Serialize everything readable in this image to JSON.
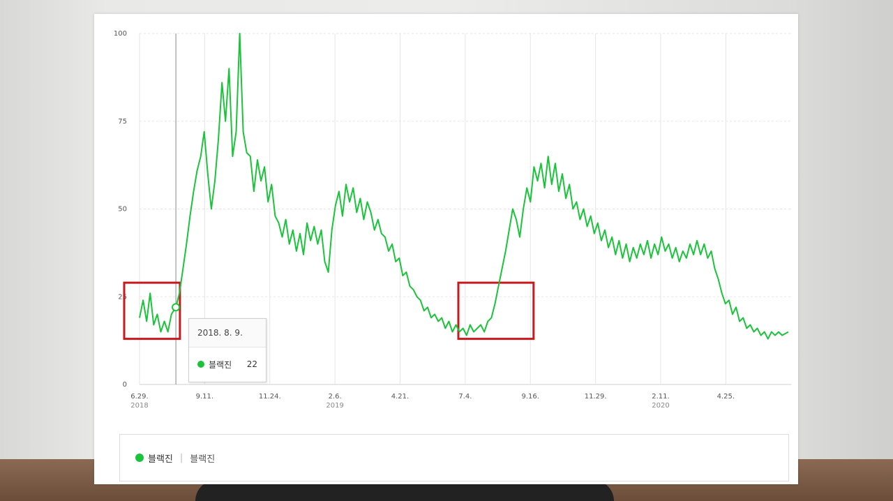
{
  "colors": {
    "line": "#1bc33b",
    "highlight": "#c8191e",
    "grid": "#e5e5e5"
  },
  "tooltip": {
    "date": "2018. 8. 9.",
    "series": "블랙진",
    "value": "22"
  },
  "legend": {
    "series_label": "블랙진",
    "series_sub": "블랙진"
  },
  "chart_data": {
    "type": "line",
    "x_start": "2018-06-29",
    "x_end": "2020-06-30",
    "ylim": [
      0,
      100
    ],
    "yticks": [
      "0",
      "25",
      "50",
      "75",
      "100"
    ],
    "xticks": [
      {
        "label": "6.29.",
        "year": "2018"
      },
      {
        "label": "9.11.",
        "year": ""
      },
      {
        "label": "11.24.",
        "year": ""
      },
      {
        "label": "2.6.",
        "year": "2019"
      },
      {
        "label": "4.21.",
        "year": ""
      },
      {
        "label": "7.4.",
        "year": ""
      },
      {
        "label": "9.16.",
        "year": ""
      },
      {
        "label": "11.29.",
        "year": ""
      },
      {
        "label": "2.11.",
        "year": "2020"
      },
      {
        "label": "4.25.",
        "year": ""
      }
    ],
    "highlights": [
      {
        "from": "2018-06-29",
        "to": "2018-08-12"
      },
      {
        "from": "2019-07-11",
        "to": "2019-09-15"
      }
    ],
    "series": [
      {
        "name": "블랙진",
        "points": [
          [
            "2018-06-29",
            19
          ],
          [
            "2018-07-03",
            24
          ],
          [
            "2018-07-07",
            18
          ],
          [
            "2018-07-11",
            26
          ],
          [
            "2018-07-15",
            17
          ],
          [
            "2018-07-19",
            20
          ],
          [
            "2018-07-23",
            15
          ],
          [
            "2018-07-27",
            18
          ],
          [
            "2018-07-31",
            15
          ],
          [
            "2018-08-04",
            20
          ],
          [
            "2018-08-09",
            22
          ],
          [
            "2018-08-13",
            26
          ],
          [
            "2018-08-17",
            33
          ],
          [
            "2018-08-21",
            40
          ],
          [
            "2018-08-25",
            48
          ],
          [
            "2018-08-29",
            55
          ],
          [
            "2018-09-02",
            61
          ],
          [
            "2018-09-06",
            65
          ],
          [
            "2018-09-10",
            72
          ],
          [
            "2018-09-14",
            60
          ],
          [
            "2018-09-18",
            50
          ],
          [
            "2018-09-22",
            58
          ],
          [
            "2018-09-26",
            70
          ],
          [
            "2018-09-30",
            86
          ],
          [
            "2018-10-04",
            75
          ],
          [
            "2018-10-08",
            90
          ],
          [
            "2018-10-12",
            65
          ],
          [
            "2018-10-16",
            72
          ],
          [
            "2018-10-20",
            100
          ],
          [
            "2018-10-24",
            72
          ],
          [
            "2018-10-28",
            66
          ],
          [
            "2018-11-01",
            65
          ],
          [
            "2018-11-05",
            55
          ],
          [
            "2018-11-09",
            64
          ],
          [
            "2018-11-13",
            58
          ],
          [
            "2018-11-17",
            62
          ],
          [
            "2018-11-21",
            52
          ],
          [
            "2018-11-25",
            57
          ],
          [
            "2018-11-29",
            48
          ],
          [
            "2018-12-03",
            46
          ],
          [
            "2018-12-07",
            42
          ],
          [
            "2018-12-11",
            47
          ],
          [
            "2018-12-15",
            40
          ],
          [
            "2018-12-19",
            44
          ],
          [
            "2018-12-23",
            38
          ],
          [
            "2018-12-27",
            43
          ],
          [
            "2018-12-31",
            37
          ],
          [
            "2019-01-04",
            46
          ],
          [
            "2019-01-08",
            41
          ],
          [
            "2019-01-12",
            45
          ],
          [
            "2019-01-16",
            40
          ],
          [
            "2019-01-20",
            44
          ],
          [
            "2019-01-24",
            35
          ],
          [
            "2019-01-28",
            32
          ],
          [
            "2019-02-01",
            44
          ],
          [
            "2019-02-05",
            51
          ],
          [
            "2019-02-09",
            55
          ],
          [
            "2019-02-13",
            48
          ],
          [
            "2019-02-17",
            57
          ],
          [
            "2019-02-21",
            52
          ],
          [
            "2019-02-25",
            56
          ],
          [
            "2019-03-01",
            49
          ],
          [
            "2019-03-05",
            53
          ],
          [
            "2019-03-09",
            47
          ],
          [
            "2019-03-13",
            52
          ],
          [
            "2019-03-17",
            49
          ],
          [
            "2019-03-21",
            44
          ],
          [
            "2019-03-25",
            47
          ],
          [
            "2019-03-29",
            43
          ],
          [
            "2019-04-02",
            42
          ],
          [
            "2019-04-06",
            38
          ],
          [
            "2019-04-10",
            40
          ],
          [
            "2019-04-14",
            35
          ],
          [
            "2019-04-18",
            36
          ],
          [
            "2019-04-22",
            31
          ],
          [
            "2019-04-26",
            32
          ],
          [
            "2019-04-30",
            28
          ],
          [
            "2019-05-04",
            27
          ],
          [
            "2019-05-08",
            25
          ],
          [
            "2019-05-12",
            24
          ],
          [
            "2019-05-16",
            21
          ],
          [
            "2019-05-20",
            22
          ],
          [
            "2019-05-24",
            19
          ],
          [
            "2019-05-28",
            20
          ],
          [
            "2019-06-01",
            18
          ],
          [
            "2019-06-05",
            19
          ],
          [
            "2019-06-09",
            16
          ],
          [
            "2019-06-13",
            18
          ],
          [
            "2019-06-17",
            15
          ],
          [
            "2019-06-21",
            17
          ],
          [
            "2019-06-25",
            15
          ],
          [
            "2019-06-29",
            16
          ],
          [
            "2019-07-03",
            14
          ],
          [
            "2019-07-07",
            17
          ],
          [
            "2019-07-11",
            15
          ],
          [
            "2019-07-15",
            16
          ],
          [
            "2019-07-19",
            17
          ],
          [
            "2019-07-23",
            15
          ],
          [
            "2019-07-27",
            18
          ],
          [
            "2019-07-31",
            19
          ],
          [
            "2019-08-04",
            23
          ],
          [
            "2019-08-08",
            28
          ],
          [
            "2019-08-12",
            33
          ],
          [
            "2019-08-16",
            38
          ],
          [
            "2019-08-20",
            44
          ],
          [
            "2019-08-24",
            50
          ],
          [
            "2019-08-28",
            47
          ],
          [
            "2019-09-01",
            42
          ],
          [
            "2019-09-05",
            50
          ],
          [
            "2019-09-09",
            56
          ],
          [
            "2019-09-13",
            52
          ],
          [
            "2019-09-17",
            62
          ],
          [
            "2019-09-21",
            58
          ],
          [
            "2019-09-25",
            63
          ],
          [
            "2019-09-29",
            56
          ],
          [
            "2019-10-03",
            65
          ],
          [
            "2019-10-07",
            57
          ],
          [
            "2019-10-11",
            63
          ],
          [
            "2019-10-15",
            55
          ],
          [
            "2019-10-19",
            60
          ],
          [
            "2019-10-23",
            53
          ],
          [
            "2019-10-27",
            57
          ],
          [
            "2019-10-31",
            50
          ],
          [
            "2019-11-04",
            52
          ],
          [
            "2019-11-08",
            47
          ],
          [
            "2019-11-12",
            50
          ],
          [
            "2019-11-16",
            45
          ],
          [
            "2019-11-20",
            48
          ],
          [
            "2019-11-24",
            43
          ],
          [
            "2019-11-28",
            46
          ],
          [
            "2019-12-02",
            41
          ],
          [
            "2019-12-06",
            44
          ],
          [
            "2019-12-10",
            39
          ],
          [
            "2019-12-14",
            42
          ],
          [
            "2019-12-18",
            37
          ],
          [
            "2019-12-22",
            41
          ],
          [
            "2019-12-26",
            36
          ],
          [
            "2019-12-30",
            40
          ],
          [
            "2020-01-03",
            35
          ],
          [
            "2020-01-07",
            39
          ],
          [
            "2020-01-11",
            36
          ],
          [
            "2020-01-15",
            40
          ],
          [
            "2020-01-19",
            37
          ],
          [
            "2020-01-23",
            41
          ],
          [
            "2020-01-27",
            36
          ],
          [
            "2020-01-31",
            40
          ],
          [
            "2020-02-04",
            37
          ],
          [
            "2020-02-08",
            42
          ],
          [
            "2020-02-12",
            38
          ],
          [
            "2020-02-16",
            40
          ],
          [
            "2020-02-20",
            36
          ],
          [
            "2020-02-24",
            39
          ],
          [
            "2020-02-28",
            35
          ],
          [
            "2020-03-03",
            38
          ],
          [
            "2020-03-07",
            36
          ],
          [
            "2020-03-11",
            40
          ],
          [
            "2020-03-15",
            37
          ],
          [
            "2020-03-19",
            41
          ],
          [
            "2020-03-23",
            37
          ],
          [
            "2020-03-27",
            40
          ],
          [
            "2020-03-31",
            36
          ],
          [
            "2020-04-04",
            38
          ],
          [
            "2020-04-08",
            33
          ],
          [
            "2020-04-12",
            30
          ],
          [
            "2020-04-16",
            26
          ],
          [
            "2020-04-20",
            23
          ],
          [
            "2020-04-24",
            24
          ],
          [
            "2020-04-28",
            20
          ],
          [
            "2020-05-02",
            22
          ],
          [
            "2020-05-06",
            18
          ],
          [
            "2020-05-10",
            19
          ],
          [
            "2020-05-14",
            16
          ],
          [
            "2020-05-18",
            17
          ],
          [
            "2020-05-22",
            15
          ],
          [
            "2020-05-26",
            16
          ],
          [
            "2020-05-30",
            14
          ],
          [
            "2020-06-03",
            15
          ],
          [
            "2020-06-07",
            13
          ],
          [
            "2020-06-11",
            15
          ],
          [
            "2020-06-15",
            14
          ],
          [
            "2020-06-19",
            15
          ],
          [
            "2020-06-23",
            14
          ],
          [
            "2020-06-30",
            15
          ]
        ]
      }
    ]
  }
}
